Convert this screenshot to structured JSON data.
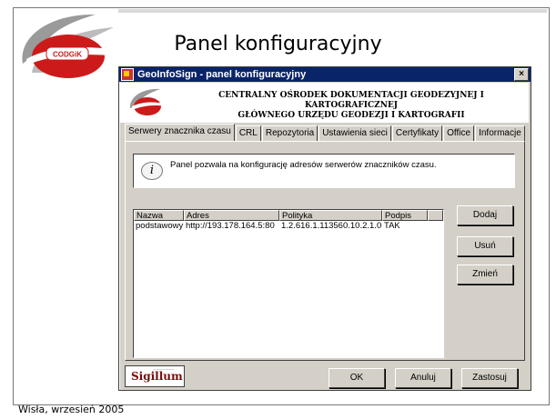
{
  "slide": {
    "title": "Panel konfiguracyjny",
    "footer": "Wisła, wrzesień 2005",
    "logo_text": "CODGiK"
  },
  "window": {
    "title": "GeoInfoSign - panel konfiguracyjny",
    "close_glyph": "×",
    "header_line1": "CENTRALNY OŚRODEK DOKUMENTACJI GEODEZYJNEJ I KARTOGRAFICZNEJ",
    "header_line2": "GŁÓWNEGO URZĘDU GEODEZJI I KARTOGRAFII"
  },
  "tabs": [
    "Serwery znacznika czasu",
    "CRL",
    "Repozytoria",
    "Ustawienia sieci",
    "Certyfikaty",
    "Office",
    "Informacje"
  ],
  "info": {
    "icon": "i",
    "text": "Panel pozwala na konfigurację adresów serwerów znaczników czasu."
  },
  "table": {
    "columns": [
      "Nazwa",
      "Adres",
      "Polityka",
      "Podpis"
    ],
    "rows": [
      [
        "podstawowy",
        "http://193.178.164.5:80",
        "1.2.616.1.113560.10.2.1.0",
        "TAK"
      ]
    ]
  },
  "buttons": {
    "add": "Dodaj",
    "remove": "Usuń",
    "change": "Zmień",
    "ok": "OK",
    "cancel": "Anuluj",
    "apply": "Zastosuj"
  },
  "stamp": {
    "label": "Sigillum"
  },
  "colors": {
    "titlebar": "#0a246a",
    "window_bg": "#d4d0c8",
    "logo_red": "#cc1a1a"
  }
}
